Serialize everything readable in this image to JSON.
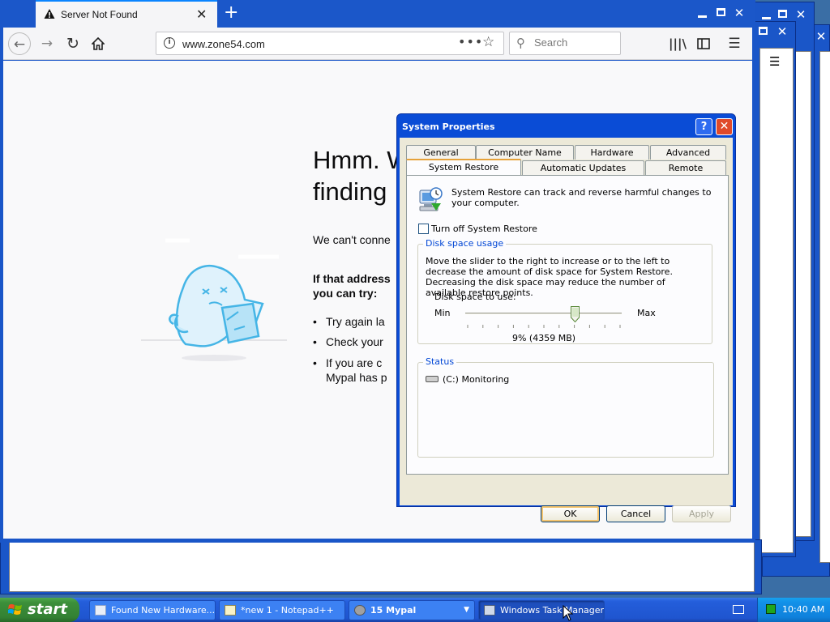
{
  "browser": {
    "tab_title": "Server Not Found",
    "url": "www.zone54.com",
    "search_placeholder": "Search",
    "error": {
      "title_line1": "Hmm. W",
      "title_line2": "finding",
      "description": "We can't conne",
      "try_heading_line1": "If that address",
      "try_heading_line2": "you can try:",
      "items": [
        "Try again la",
        "Check your",
        "If you are c",
        "Mypal has p"
      ]
    }
  },
  "dialog": {
    "title": "System Properties",
    "help": "?",
    "tabs_back": [
      "General",
      "Computer Name",
      "Hardware",
      "Advanced"
    ],
    "tabs_front": [
      "System Restore",
      "Automatic Updates",
      "Remote"
    ],
    "intro": "System Restore can track and reverse harmful changes to your computer.",
    "turn_off_label": "Turn off System Restore",
    "turn_off_checked": false,
    "disk_group": "Disk space usage",
    "disk_description": "Move the slider to the right to increase or to the left to decrease the amount of disk space for System Restore. Decreasing the disk space may reduce the number of available restore points.",
    "disk_to_use": "Disk space to use:",
    "min": "Min",
    "max": "Max",
    "disk_value": "9% (4359 MB)",
    "slider_fraction": 0.7,
    "status_group": "Status",
    "drive_status": "(C:) Monitoring",
    "buttons": {
      "ok": "OK",
      "cancel": "Cancel",
      "apply": "Apply"
    }
  },
  "taskbar": {
    "start": "start",
    "tasks": [
      {
        "label": "Found New Hardware...",
        "icon": "hardware-icon"
      },
      {
        "label": "*new 1 - Notepad++",
        "icon": "notepad-icon"
      },
      {
        "label": "15 Mypal",
        "icon": "mypal-icon"
      },
      {
        "label": "Windows Task Manager",
        "icon": "taskmanager-icon"
      }
    ],
    "clock": "10:40 AM"
  },
  "colors": {
    "xp_blue": "#0a4cd6",
    "tab_accent": "#0a84ff",
    "start_green": "#3c8f3a",
    "group_label": "#0046d5"
  }
}
